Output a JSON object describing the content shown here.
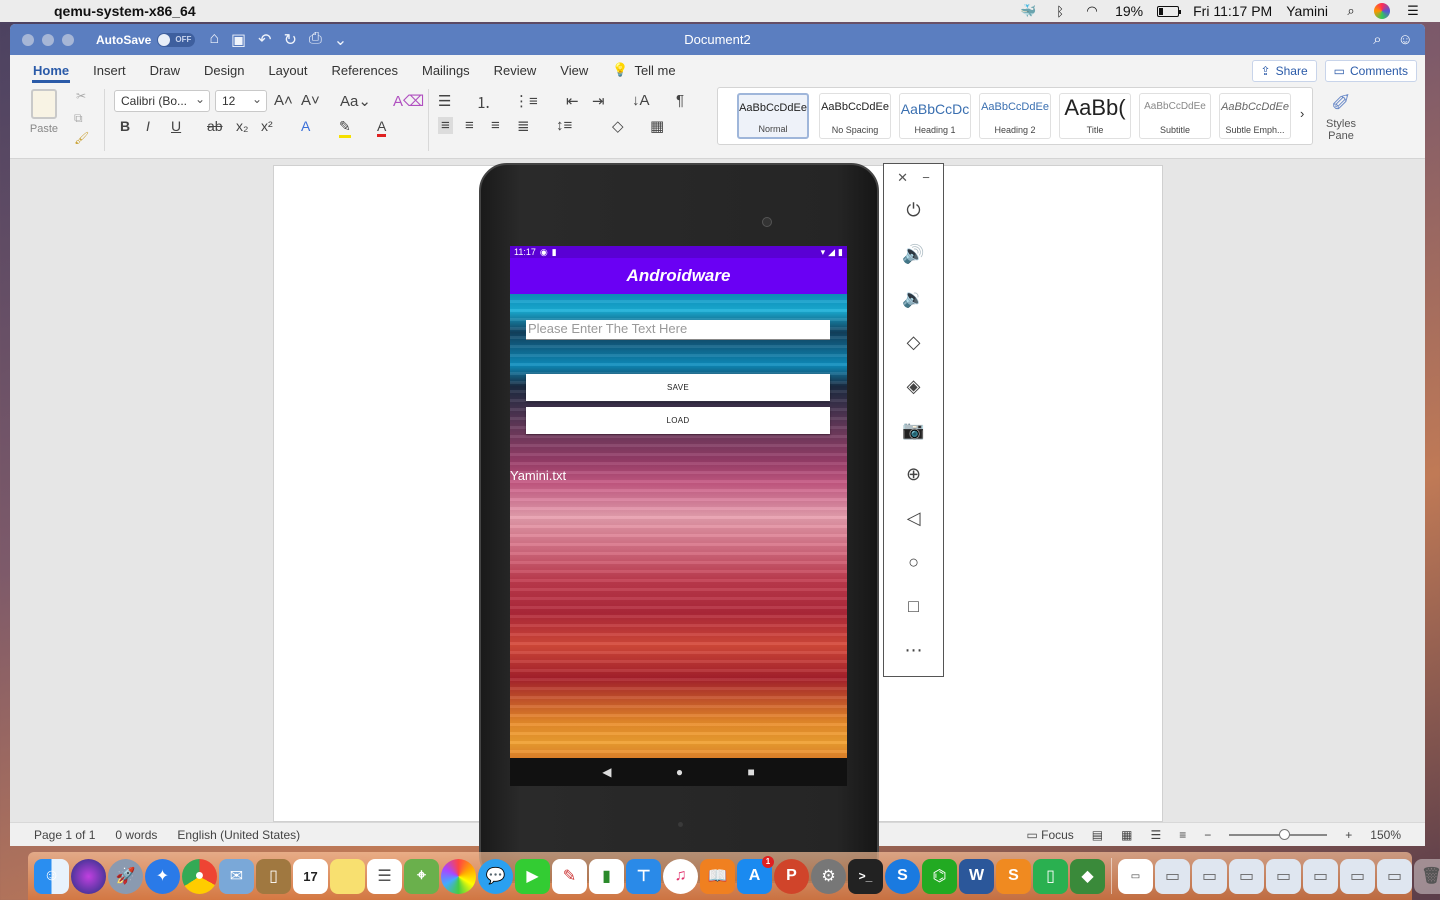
{
  "menubar": {
    "app_name": "qemu-system-x86_64",
    "battery_pct": "19%",
    "datetime": "Fri 11:17 PM",
    "user": "Yamini"
  },
  "word": {
    "autosave_label": "AutoSave",
    "autosave_state": "OFF",
    "doc_title": "Document2",
    "tabs": [
      "Home",
      "Insert",
      "Draw",
      "Design",
      "Layout",
      "References",
      "Mailings",
      "Review",
      "View"
    ],
    "tell_me": "Tell me",
    "share_label": "Share",
    "comments_label": "Comments",
    "paste_label": "Paste",
    "font_name": "Calibri (Bo...",
    "font_size": "12",
    "styles": [
      {
        "sample": "AaBbCcDdEe",
        "name": "Normal"
      },
      {
        "sample": "AaBbCcDdEe",
        "name": "No Spacing"
      },
      {
        "sample": "AaBbCcDc",
        "name": "Heading 1"
      },
      {
        "sample": "AaBbCcDdEe",
        "name": "Heading 2"
      },
      {
        "sample": "AaBb(",
        "name": "Title"
      },
      {
        "sample": "AaBbCcDdEe",
        "name": "Subtitle"
      },
      {
        "sample": "AaBbCcDdEe",
        "name": "Subtle Emph..."
      }
    ],
    "styles_pane_label": "Styles Pane",
    "status": {
      "page": "Page 1 of 1",
      "words": "0 words",
      "language": "English (United States)",
      "focus": "Focus",
      "zoom": "150%"
    }
  },
  "android": {
    "time": "11:17",
    "app_title": "Androidware",
    "input_placeholder": "Please Enter The Text Here",
    "save_label": "SAVE",
    "load_label": "LOAD",
    "file_name": "Yamini.txt"
  },
  "emulator_panel": {
    "controls": [
      "power-icon",
      "volume-up-icon",
      "volume-down-icon",
      "rotate-left-icon",
      "rotate-right-icon",
      "camera-icon",
      "zoom-icon",
      "back-icon",
      "home-icon",
      "overview-icon",
      "more-icon"
    ]
  },
  "dock": {
    "badges": {
      "calendar_day": "17",
      "appstore_badge": "1"
    }
  }
}
